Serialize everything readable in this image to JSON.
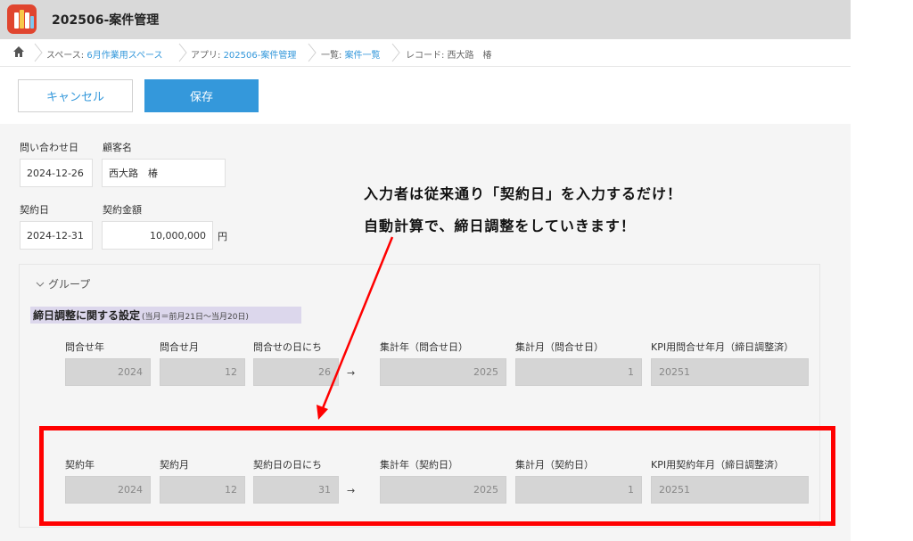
{
  "header": {
    "title": "202506-案件管理",
    "icon": "app-books-icon"
  },
  "breadcrumb": {
    "space_prefix": "スペース: ",
    "space": "6月作業用スペース",
    "app_prefix": "アプリ: ",
    "app": "202506-案件管理",
    "list_prefix": "一覧: ",
    "list": "案件一覧",
    "record": "レコード: 西大路　椿"
  },
  "actions": {
    "cancel": "キャンセル",
    "save": "保存"
  },
  "form": {
    "inquiry_date_label": "問い合わせ日",
    "inquiry_date": "2024-12-26",
    "customer_label": "顧客名",
    "customer": "西大路　椿",
    "contract_date_label": "契約日",
    "contract_date": "2024-12-31",
    "amount_label": "契約金額",
    "amount": "10,000,000",
    "amount_unit": "円"
  },
  "annotation": {
    "line1": "入力者は従来通り「契約日」を入力するだけ！",
    "line2": "自動計算で、締日調整をしていきます！"
  },
  "group": {
    "label": "グループ",
    "section_title": "締日調整に関する設定",
    "section_sub": "(当月＝前月21日〜当月20日)",
    "arrow_symbol": "→",
    "inquiry": {
      "labels": [
        "問合せ年",
        "問合せ月",
        "問合せの日にち",
        "集計年（問合せ日）",
        "集計月（問合せ日）",
        "KPI用問合せ年月（締日調整済）"
      ],
      "values": [
        "2024",
        "12",
        "26",
        "2025",
        "1",
        "20251"
      ]
    },
    "contract": {
      "labels": [
        "契約年",
        "契約月",
        "契約日の日にち",
        "集計年（契約日）",
        "集計月（契約日）",
        "KPI用契約年月（締日調整済）"
      ],
      "values": [
        "2024",
        "12",
        "31",
        "2025",
        "1",
        "20251"
      ]
    }
  },
  "colors": {
    "accent": "#3498db",
    "highlight": "#ff0000",
    "section_bg": "#dcd7ec"
  }
}
